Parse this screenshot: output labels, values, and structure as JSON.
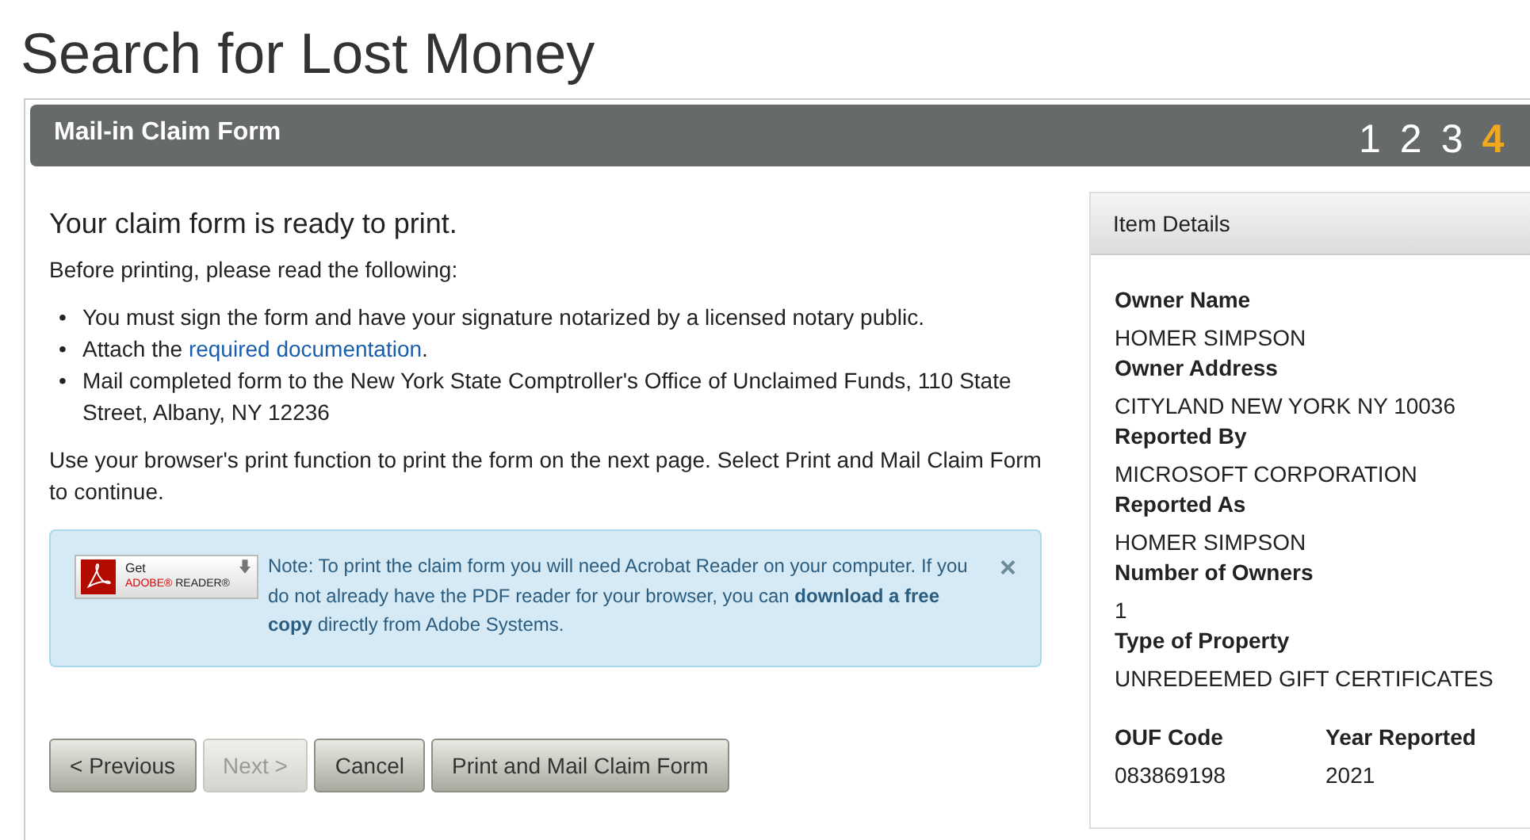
{
  "page_title": "Search for Lost Money",
  "panel": {
    "title": "Mail-in Claim Form",
    "steps": [
      {
        "label": "1",
        "selected": false
      },
      {
        "label": "2",
        "selected": false
      },
      {
        "label": "3",
        "selected": false
      },
      {
        "label": "4",
        "selected": true
      }
    ]
  },
  "main": {
    "heading": "Your claim form is ready to print.",
    "intro": "Before printing, please read the following:",
    "bullets": [
      {
        "marker": "•",
        "text": "You must sign the form and have your signature notarized by a licensed notary public."
      },
      {
        "marker": "•",
        "text": "Attach the ",
        "link": "required documentation",
        "after": "."
      },
      {
        "marker": "•",
        "text": "Mail completed form to the New York State Comptroller's Office of Unclaimed Funds, 110 State Street, Albany, NY 12236"
      }
    ],
    "instructions": "Use your browser's print function to print the form on the next page. Select Print and Mail Claim Form to continue.",
    "notice": {
      "badge_small": "Get",
      "badge_brand": "ADOBE®",
      "badge_product": "READER®",
      "text": "Note: To print the claim form you will need Acrobat Reader on your computer. If you do not already have the PDF reader for your browser, you can **download a free copy** directly from Adobe Systems.",
      "close": "×"
    },
    "buttons": [
      {
        "label": "< Previous",
        "disabled": false
      },
      {
        "label": "Next >",
        "disabled": true
      },
      {
        "label": "Cancel",
        "disabled": false
      },
      {
        "label": "Print and Mail Claim Form",
        "disabled": false
      }
    ]
  },
  "item_details": {
    "title": "Item Details",
    "fields": [
      {
        "label": "Owner Name",
        "value": "HOMER SIMPSON"
      },
      {
        "label": "Owner Address",
        "value": "CITYLAND NEW YORK NY 10036"
      },
      {
        "label": "Reported By",
        "value": "MICROSOFT CORPORATION"
      },
      {
        "label": "Reported As",
        "value": "HOMER SIMPSON"
      },
      {
        "label": "Number of Owners",
        "value": "1"
      },
      {
        "label": "Type of Property",
        "value": "UNREDEEMED GIFT CERTIFICATES"
      }
    ],
    "pair": [
      {
        "label": "OUF Code",
        "value": "083869198"
      },
      {
        "label": "Year Reported",
        "value": "2021"
      }
    ]
  }
}
